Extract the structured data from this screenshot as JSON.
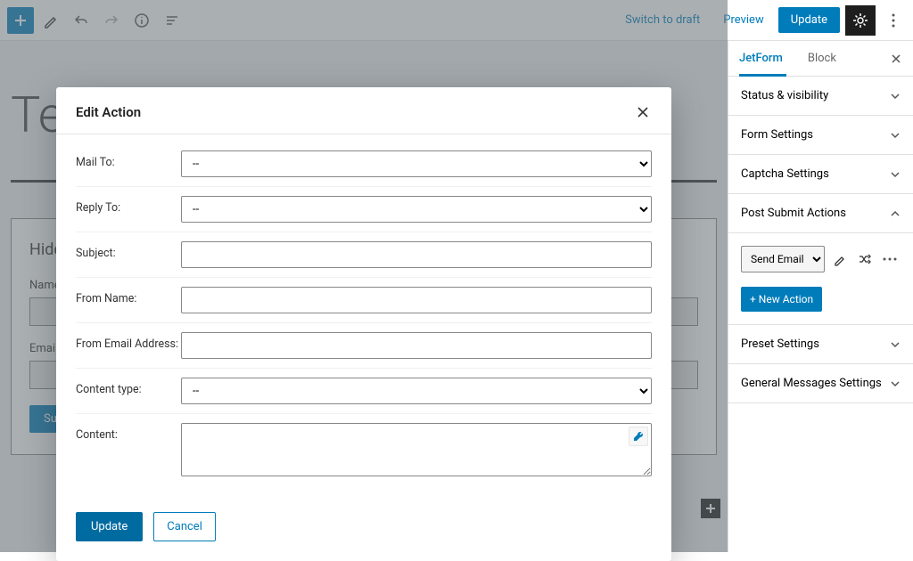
{
  "toolbar": {
    "switch_draft": "Switch to draft",
    "preview": "Preview",
    "update": "Update"
  },
  "page": {
    "title": "Test Form",
    "hidden_field_label": "Hidden Fie",
    "name_label": "Name",
    "email_label": "Email",
    "submit_label": "Submit"
  },
  "sidebar": {
    "tab_jetform": "JetForm",
    "tab_block": "Block",
    "panels": {
      "status": "Status & visibility",
      "form_settings": "Form Settings",
      "captcha": "Captcha Settings",
      "post_submit": "Post Submit Actions",
      "preset": "Preset Settings",
      "general_messages": "General Messages Settings"
    },
    "action_select": "Send Email",
    "new_action": "+ New Action"
  },
  "modal": {
    "title": "Edit Action",
    "labels": {
      "mail_to": "Mail To:",
      "reply_to": "Reply To:",
      "subject": "Subject:",
      "from_name": "From Name:",
      "from_email": "From Email Address:",
      "content_type": "Content type:",
      "content": "Content:"
    },
    "select_placeholder": "--",
    "update": "Update",
    "cancel": "Cancel"
  }
}
